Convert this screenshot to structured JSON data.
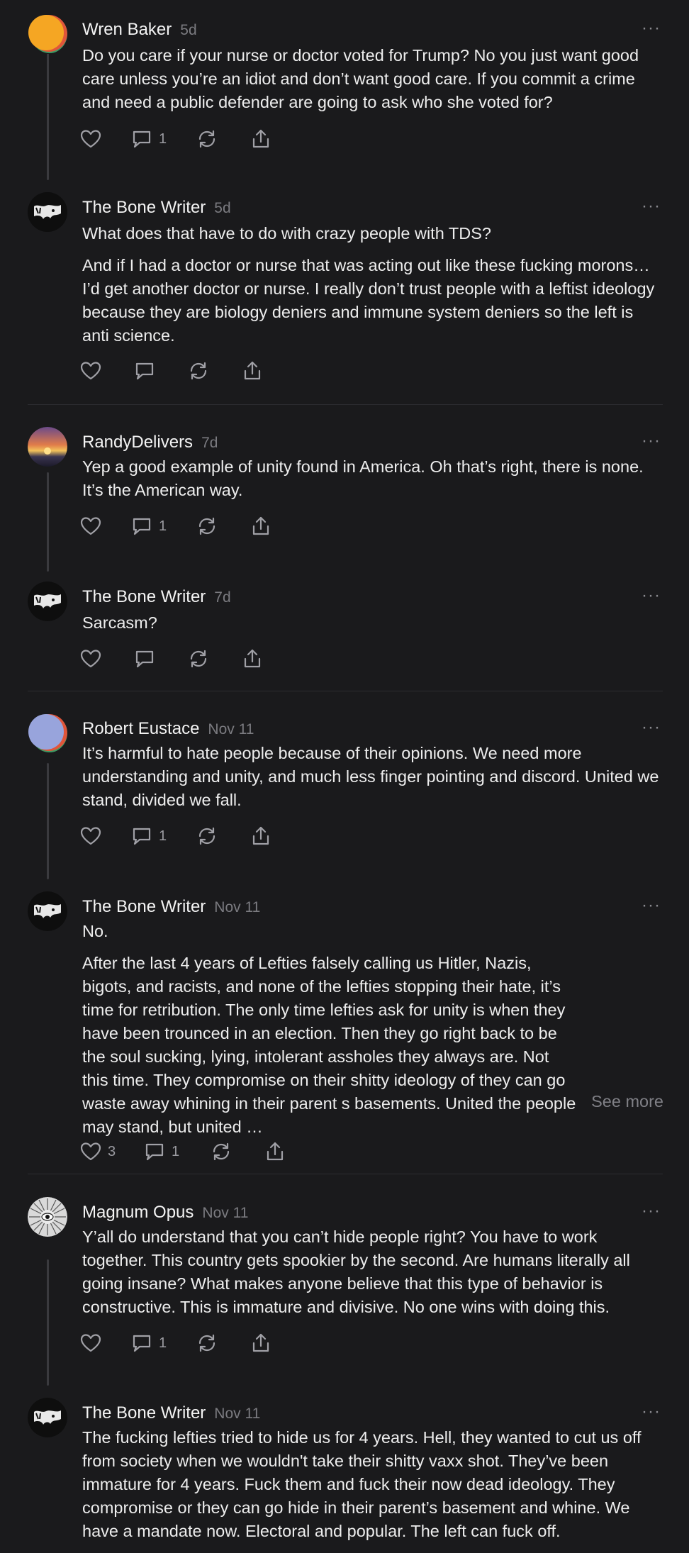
{
  "icons": {
    "like": "heart-icon",
    "reply": "comment-icon",
    "repost": "repost-icon",
    "share": "share-icon",
    "more": "more-dots-icon"
  },
  "more_label": "···",
  "see_more": "See more",
  "posts": [
    {
      "author": "Wren Baker",
      "time": "5d",
      "paragraphs": [
        "Do you care if your nurse or doctor voted for Trump? No you just want good care unless you’re an idiot and don’t want good care. If you commit a crime and need a public defender are going to ask who she voted for?"
      ],
      "likes": "",
      "replies": "1"
    },
    {
      "author": "The Bone Writer",
      "time": "5d",
      "paragraphs": [
        "What does that have to do with crazy people with TDS?",
        "And if I had a doctor or nurse that was acting out like these fucking morons… I’d get another doctor or nurse. I really don’t trust people with a leftist ideology because they are biology deniers and immune system deniers so the left is anti science."
      ],
      "likes": "",
      "replies": ""
    },
    {
      "author": "RandyDelivers",
      "time": "7d",
      "paragraphs": [
        "Yep a good example of unity found in America. Oh that’s right, there is none. It’s the American way."
      ],
      "likes": "",
      "replies": "1"
    },
    {
      "author": "The Bone Writer",
      "time": "7d",
      "paragraphs": [
        "Sarcasm?"
      ],
      "likes": "",
      "replies": ""
    },
    {
      "author": "Robert Eustace",
      "time": "Nov 11",
      "paragraphs": [
        "It’s harmful to hate people because of their opinions. We need more understanding and unity, and much less finger pointing and discord. United we stand, divided we fall."
      ],
      "likes": "",
      "replies": "1"
    },
    {
      "author": "The Bone Writer",
      "time": "Nov 11",
      "paragraphs": [
        "No.",
        "After the last 4 years of Lefties falsely calling us Hitler, Nazis, bigots, and racists, and none of the lefties stopping their hate, it’s time for retribution. The only time lefties ask for unity is when they have been trounced in an election. Then they go right back to be the soul sucking, lying, intolerant assholes they always are. Not this time. They compromise on their shitty ideology of they can go waste away whining in their parent s basements. United the people may stand, but united …"
      ],
      "likes": "3",
      "replies": "1"
    },
    {
      "author": "Magnum Opus",
      "time": "Nov 11",
      "paragraphs": [
        "Y’all do understand that you can’t hide people right? You have to work together. This country gets spookier by the second. Are humans literally all going insane? What makes anyone believe that this type of behavior is constructive. This is immature and divisive. No one wins with doing this."
      ],
      "likes": "",
      "replies": "1"
    },
    {
      "author": "The Bone Writer",
      "time": "Nov 11",
      "paragraphs": [
        "The fucking lefties tried to hide us for 4 years. Hell, they wanted to cut us off from society when we wouldn't take their shitty vaxx shot. They’ve been immature for 4 years. Fuck them and fuck their now dead ideology. They compromise or they can go hide in their parent’s basement and whine. We have a mandate now. Electoral and popular. The left can fuck off."
      ],
      "likes": "",
      "replies": ""
    }
  ]
}
